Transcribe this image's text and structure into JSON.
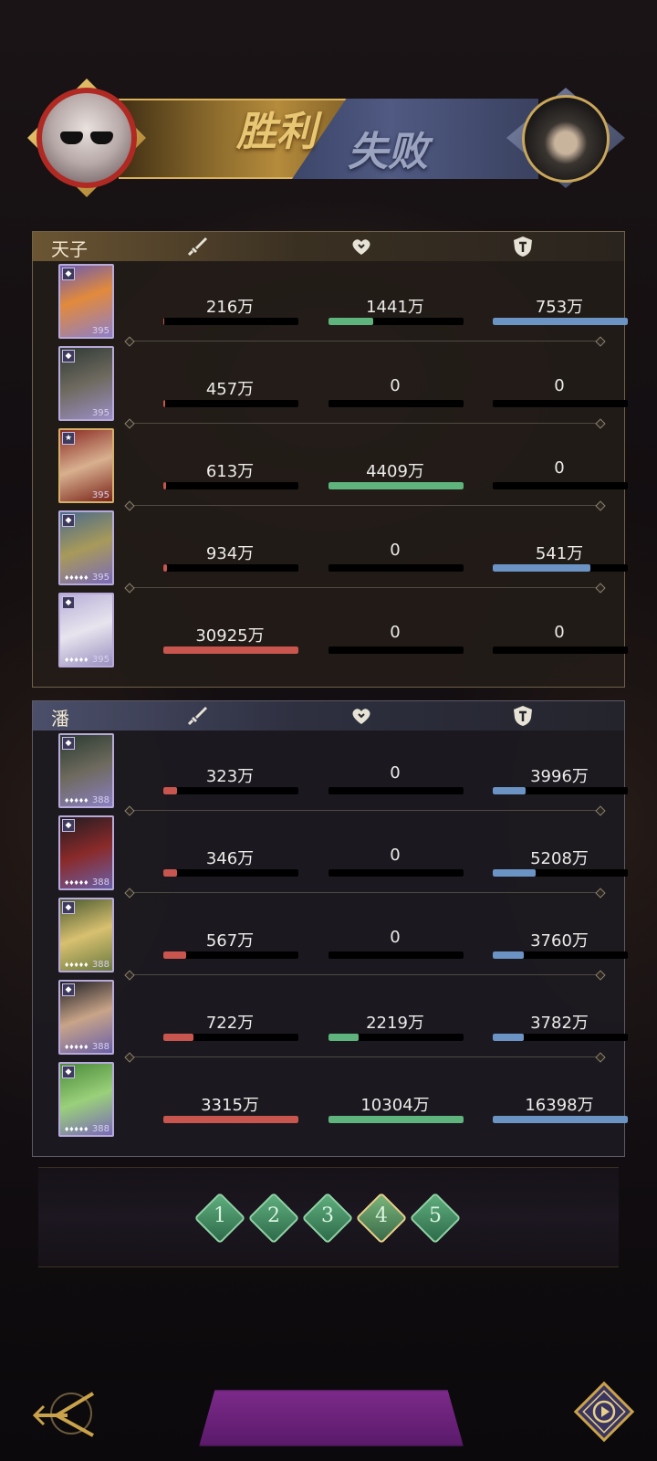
{
  "header": {
    "win_label": "胜利",
    "lose_label": "失败"
  },
  "icons": {
    "attack": "sword-icon",
    "heal": "heart-icon",
    "defense": "shield-icon"
  },
  "colors": {
    "attack_bar": "#c8564e",
    "heal_bar": "#5eb47c",
    "defense_bar": "#6b93c4"
  },
  "ally_team": {
    "name": "天子",
    "heroes": [
      {
        "attack": "216万",
        "heal": "1441万",
        "defense": "753万",
        "atk_pct": 0.01,
        "heal_pct": 0.33,
        "def_pct": 1.0,
        "level": "395"
      },
      {
        "attack": "457万",
        "heal": "0",
        "defense": "0",
        "atk_pct": 0.015,
        "heal_pct": 0,
        "def_pct": 0,
        "level": "395"
      },
      {
        "attack": "613万",
        "heal": "4409万",
        "defense": "0",
        "atk_pct": 0.02,
        "heal_pct": 1.0,
        "def_pct": 0,
        "level": "395"
      },
      {
        "attack": "934万",
        "heal": "0",
        "defense": "541万",
        "atk_pct": 0.03,
        "heal_pct": 0,
        "def_pct": 0.72,
        "level": "395"
      },
      {
        "attack": "30925万",
        "heal": "0",
        "defense": "0",
        "atk_pct": 1.0,
        "heal_pct": 0,
        "def_pct": 0,
        "level": "395"
      }
    ]
  },
  "enemy_team": {
    "name": "潘",
    "heroes": [
      {
        "attack": "323万",
        "heal": "0",
        "defense": "3996万",
        "atk_pct": 0.1,
        "heal_pct": 0,
        "def_pct": 0.24,
        "level": "388"
      },
      {
        "attack": "346万",
        "heal": "0",
        "defense": "5208万",
        "atk_pct": 0.1,
        "heal_pct": 0,
        "def_pct": 0.32,
        "level": "388"
      },
      {
        "attack": "567万",
        "heal": "0",
        "defense": "3760万",
        "atk_pct": 0.17,
        "heal_pct": 0,
        "def_pct": 0.23,
        "level": "388"
      },
      {
        "attack": "722万",
        "heal": "2219万",
        "defense": "3782万",
        "atk_pct": 0.22,
        "heal_pct": 0.22,
        "def_pct": 0.23,
        "level": "388"
      },
      {
        "attack": "3315万",
        "heal": "10304万",
        "defense": "16398万",
        "atk_pct": 1.0,
        "heal_pct": 1.0,
        "def_pct": 1.0,
        "level": "388"
      }
    ]
  },
  "rounds": {
    "labels": [
      "1",
      "2",
      "3",
      "4",
      "5"
    ],
    "active_index": 3
  }
}
